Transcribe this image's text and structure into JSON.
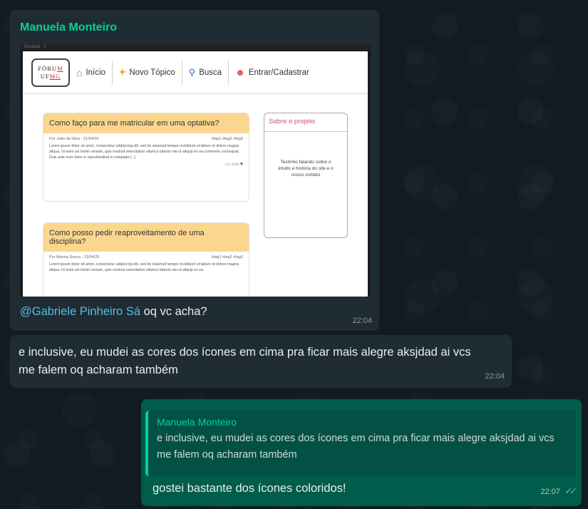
{
  "messages": [
    {
      "sender": "Manuela Monteiro",
      "image": {
        "topbar": "Desktop - 2",
        "logo": {
          "line1_a": "FÓRU",
          "line1_b": "M",
          "line2_a": "UF",
          "line2_b": "MG"
        },
        "nav": {
          "home": "Início",
          "new_topic": "Novo Tópico",
          "search": "Busca",
          "login": "Entrar/Cadastrar"
        },
        "posts": [
          {
            "title": "Como faço para me matricular em uma optativa?",
            "meta": "Por João da Silva - 21/04/25",
            "tags": "#tag1 #tag2 #tag3",
            "body": "Lorem ipsum dolor sit amet, consectetur adipiscing elit, sed do eiusmod tempor incididunt ut labore et dolore magna aliqua. Ut enim ad minim veniam, quis nostrud exercitation ullamco laboris nisi ut aliquip ex ea commodo consequat. Duis aute irure dolor in reprehenderit in voluptate [...]",
            "more": "Ler mais"
          },
          {
            "title": "Como posso pedir reaproveitamento de uma disciplina?",
            "meta": "Por Marina Souza - 21/04/25",
            "tags": "#tag1 #tag2 #tag3",
            "body": "Lorem ipsum dolor sit amet, consectetur adipiscing elit, sed do eiusmod tempor incididunt ut labore et dolore magna aliqua. Ut enim ad minim veniam, quis nostrud exercitation ullamco laboris nisi ut aliquip ex ea",
            "more": ""
          }
        ],
        "about": {
          "title": "Sobre o projeto",
          "text": "Textinho falando sobre o intuito e história do site e o nosso contato"
        }
      },
      "mention": "@Gabriele Pinheiro Sá",
      "text": " oq vc acha?",
      "time": "22:04"
    },
    {
      "text": "e inclusive, eu mudei as cores dos ícones em cima pra ficar mais alegre aksjdad ai vcs me falem oq acharam também",
      "time": "22:04"
    },
    {
      "quote_sender": "Manuela Monteiro",
      "quote_text": "e inclusive, eu mudei as cores dos ícones em cima pra ficar mais alegre aksjdad ai vcs me falem oq acharam também",
      "text": "gostei bastante dos ícones coloridos!",
      "time": "22:07",
      "status_icon": "double-check-icon",
      "status_color": "#53bdeb"
    }
  ],
  "colors": {
    "incoming_bubble": "#202c33",
    "outgoing_bubble": "#005c4b",
    "sender_name": "#06cf9c",
    "mention": "#53bdeb"
  }
}
